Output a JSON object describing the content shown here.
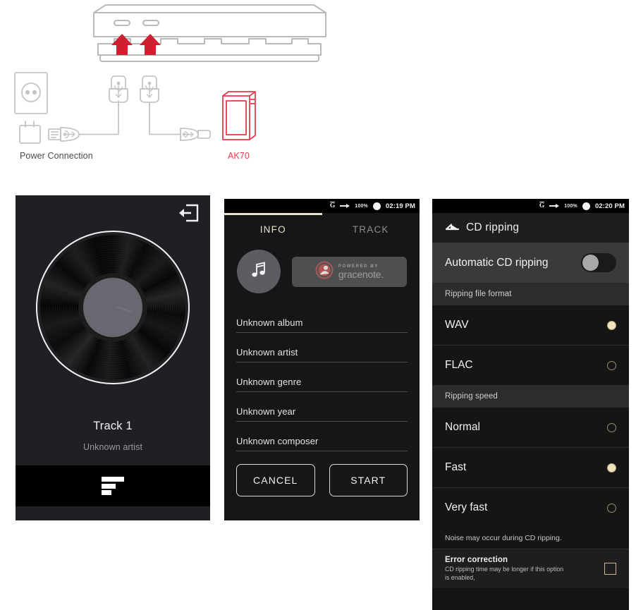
{
  "diagram": {
    "power_label": "Power Connection",
    "device_label": "AK70",
    "accent_red": "#e8384f",
    "line_gray": "#b9b9b9",
    "icons": {
      "dock": "cd-ripper-dock",
      "arrow_up": "insert-arrow-up-icon",
      "wall_outlet": "wall-outlet-icon",
      "power_adapter": "power-adapter-icon",
      "usb_a": "usb-type-a-connector-icon",
      "usb_b": "usb-type-b-connector-icon",
      "micro_usb": "micro-usb-connector-icon",
      "player": "ak70-player-icon"
    }
  },
  "screen1": {
    "name": "now-playing-screen",
    "exit_icon": "exit-icon",
    "album_art_icon": "vinyl-record-art",
    "vinyl_label_text": "Astell&Kern",
    "track_title": "Track 1",
    "artist": "Unknown artist",
    "playlist_icon": "track-list-icon"
  },
  "screen2": {
    "name": "cd-info-screen",
    "statusbar": {
      "gracenote_icon": "gracenote-g-icon",
      "transfer_icon": "transfer-arrow-icon",
      "battery_percent": "100%",
      "battery_icon": "battery-full-icon",
      "time": "02:19 PM"
    },
    "tabs": [
      {
        "label": "INFO",
        "active": true
      },
      {
        "label": "TRACK",
        "active": false
      }
    ],
    "album_icon": "music-note-icon",
    "gracenote": {
      "powered_by": "POWERED BY",
      "brand": "gracenote.",
      "logo_icon": "gracenote-logo-icon"
    },
    "fields": [
      {
        "name": "album-field",
        "value": "Unknown album"
      },
      {
        "name": "artist-field",
        "value": "Unknown artist"
      },
      {
        "name": "genre-field",
        "value": "Unknown genre"
      },
      {
        "name": "year-field",
        "value": "Unknown year"
      },
      {
        "name": "composer-field",
        "value": "Unknown composer"
      }
    ],
    "buttons": {
      "cancel": "CANCEL",
      "start": "START"
    }
  },
  "screen3": {
    "name": "cd-ripping-settings-screen",
    "statusbar": {
      "gracenote_icon": "gracenote-g-icon",
      "transfer_icon": "transfer-arrow-icon",
      "battery_percent": "100%",
      "battery_icon": "battery-full-icon",
      "time": "02:20 PM"
    },
    "header": {
      "back_icon": "back-arrow-icon",
      "title": "CD ripping"
    },
    "automatic": {
      "label": "Automatic CD ripping",
      "toggle_state": "off"
    },
    "file_format": {
      "header": "Ripping file format",
      "options": [
        {
          "label": "WAV",
          "selected": true
        },
        {
          "label": "FLAC",
          "selected": false
        }
      ]
    },
    "speed": {
      "header": "Ripping speed",
      "options": [
        {
          "label": "Normal",
          "selected": false
        },
        {
          "label": "Fast",
          "selected": true
        },
        {
          "label": "Very fast",
          "selected": false
        }
      ],
      "note": "Noise may occur during CD ripping."
    },
    "error_correction": {
      "title": "Error correction",
      "subtitle": "CD ripping time may be longer if this option is enabled,",
      "checked": false
    },
    "accent_selected": "#efe4bd"
  }
}
